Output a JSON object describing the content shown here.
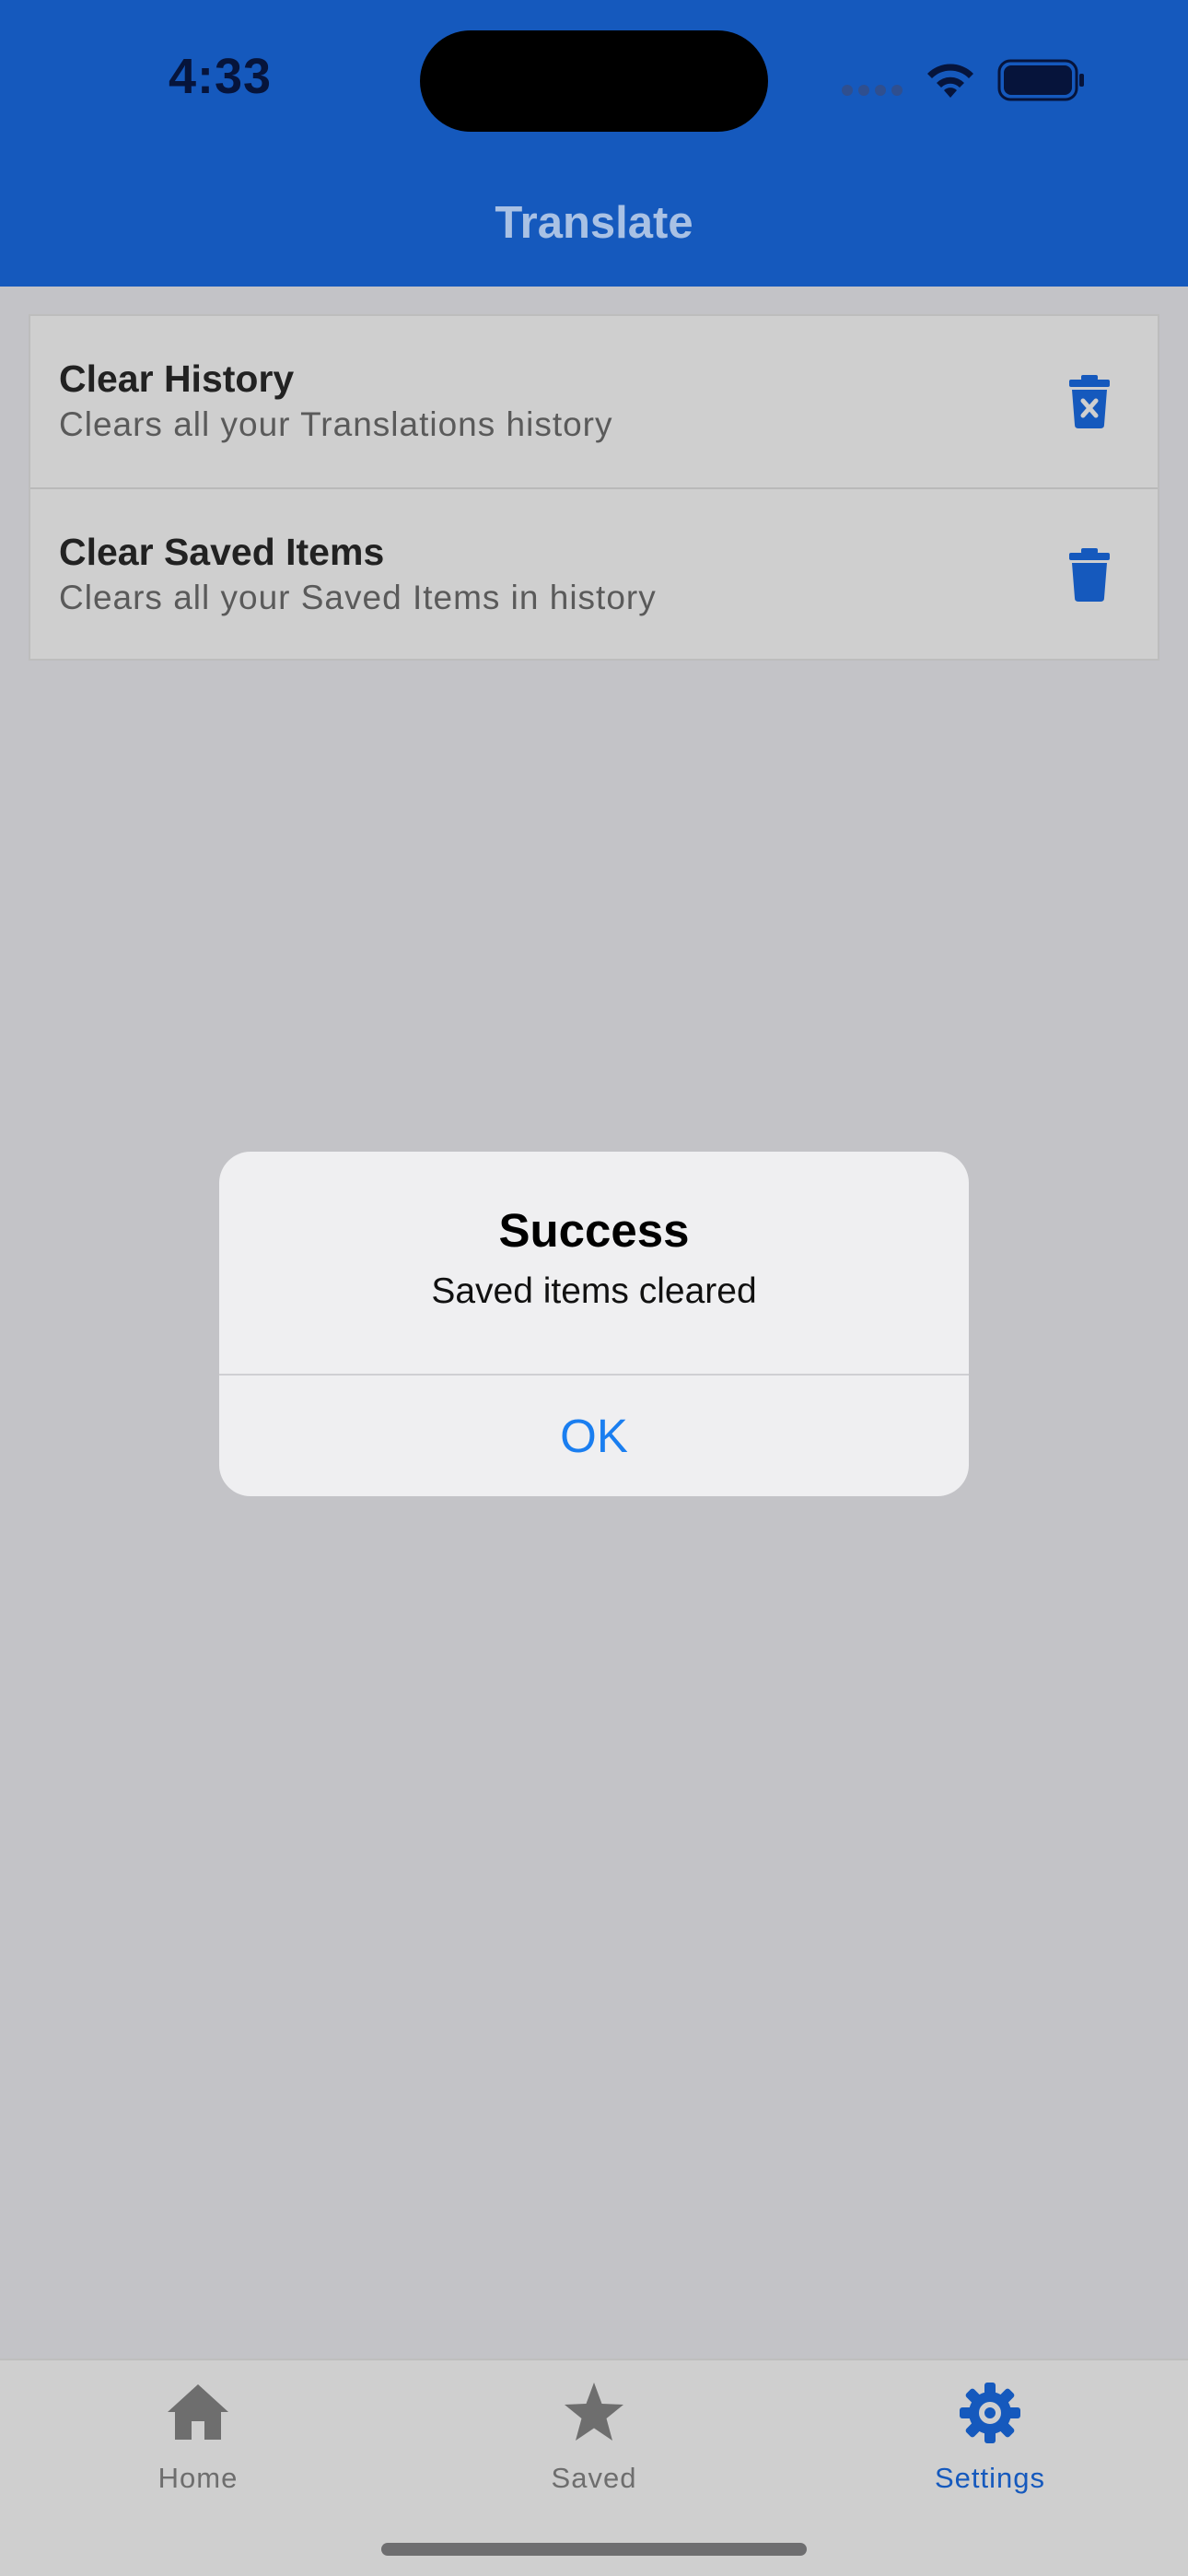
{
  "status_bar": {
    "time": "4:33"
  },
  "header": {
    "title": "Translate"
  },
  "settings": {
    "items": [
      {
        "title": "Clear History",
        "subtitle": "Clears all your Translations history",
        "icon": "trash-x-icon"
      },
      {
        "title": "Clear Saved Items",
        "subtitle": "Clears all your Saved Items in history",
        "icon": "trash-icon"
      }
    ]
  },
  "alert": {
    "title": "Success",
    "message": "Saved items cleared",
    "ok_label": "OK"
  },
  "tabbar": {
    "tabs": [
      {
        "label": "Home",
        "icon": "home-icon",
        "active": false
      },
      {
        "label": "Saved",
        "icon": "star-icon",
        "active": false
      },
      {
        "label": "Settings",
        "icon": "gear-icon",
        "active": true
      }
    ]
  },
  "colors": {
    "header_bg": "#1559bd",
    "accent": "#1559bd",
    "inactive_tab": "#6e6e6e",
    "alert_button": "#1a7ef0",
    "overlay_bg": "#c3c3c7"
  }
}
